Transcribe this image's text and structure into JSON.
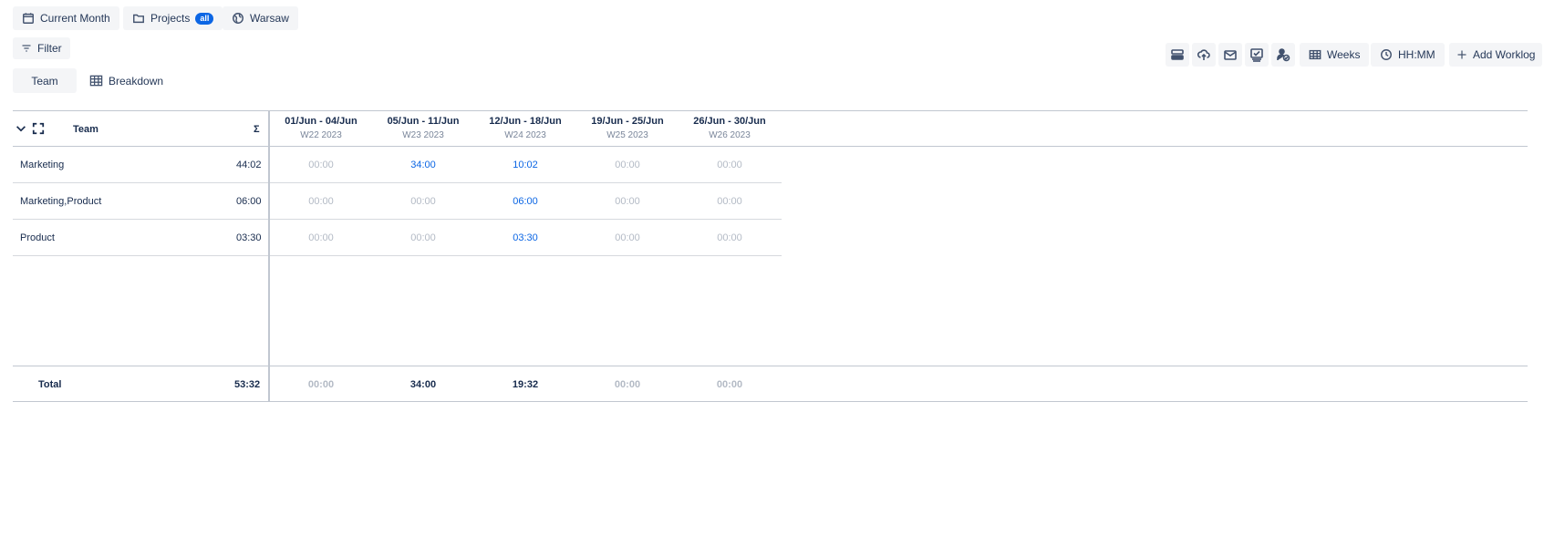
{
  "toolbar": {
    "current_month_label": "Current Month",
    "projects_label": "Projects",
    "projects_badge": "all",
    "location_label": "Warsaw",
    "filter_label": "Filter",
    "weeks_label": "Weeks",
    "time_format_label": "HH:MM",
    "add_worklog_label": "Add Worklog"
  },
  "icons": [
    "calendar-icon",
    "folder-icon",
    "globe-icon",
    "filter-icon",
    "stack-icon",
    "cloud-upload-icon",
    "mail-icon",
    "approval-icon",
    "user-check-icon",
    "table-icon",
    "clock-icon",
    "plus-icon",
    "chevron-down-icon",
    "expand-icon"
  ],
  "tabs": {
    "team": "Team",
    "breakdown": "Breakdown"
  },
  "table": {
    "group_header": "Team",
    "sum_header": "Σ",
    "weeks": [
      {
        "range": "01/Jun - 04/Jun",
        "week": "W22 2023"
      },
      {
        "range": "05/Jun - 11/Jun",
        "week": "W23 2023"
      },
      {
        "range": "12/Jun - 18/Jun",
        "week": "W24 2023"
      },
      {
        "range": "19/Jun - 25/Jun",
        "week": "W25 2023"
      },
      {
        "range": "26/Jun - 30/Jun",
        "week": "W26 2023"
      }
    ],
    "rows": [
      {
        "name": "Marketing",
        "total": "44:02",
        "values": [
          "00:00",
          "34:00",
          "10:02",
          "00:00",
          "00:00"
        ]
      },
      {
        "name": "Marketing,Product",
        "total": "06:00",
        "values": [
          "00:00",
          "00:00",
          "06:00",
          "00:00",
          "00:00"
        ]
      },
      {
        "name": "Product",
        "total": "03:30",
        "values": [
          "00:00",
          "00:00",
          "03:30",
          "00:00",
          "00:00"
        ]
      }
    ],
    "footer": {
      "label": "Total",
      "total": "53:32",
      "values": [
        "00:00",
        "34:00",
        "19:32",
        "00:00",
        "00:00"
      ]
    }
  },
  "colors": {
    "accent": "#0c66e4",
    "muted": "#b3bac5",
    "text": "#172b4d"
  }
}
